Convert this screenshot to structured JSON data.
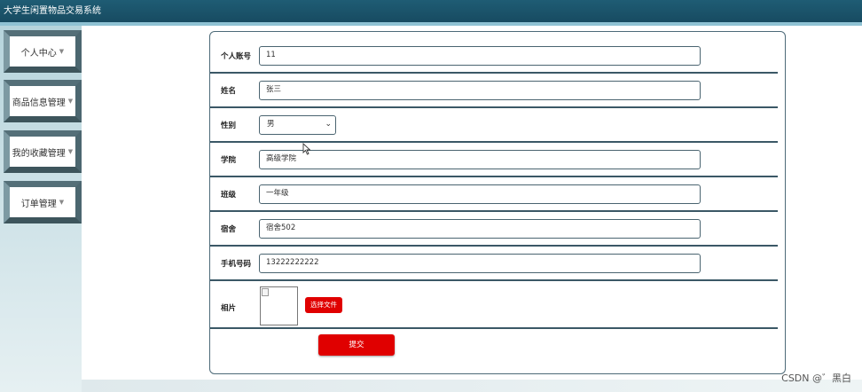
{
  "app": {
    "title": "大学生闲置物品交易系统"
  },
  "sidebar": {
    "items": [
      {
        "label": "个人中心"
      },
      {
        "label": "商品信息管理"
      },
      {
        "label": "我的收藏管理"
      },
      {
        "label": "订单管理"
      }
    ]
  },
  "form": {
    "fields": [
      {
        "label": "个人账号",
        "value": "11"
      },
      {
        "label": "姓名",
        "value": "张三"
      },
      {
        "label": "性别",
        "value": "男"
      },
      {
        "label": "学院",
        "value": "高级学院"
      },
      {
        "label": "班级",
        "value": "一年级"
      },
      {
        "label": "宿舍",
        "value": "宿舍502"
      },
      {
        "label": "手机号码",
        "value": "13222222222"
      }
    ],
    "photo_label": "相片",
    "file_button": "选择文件",
    "submit_button": "提交"
  },
  "watermark": "CSDN @゛黑白"
}
